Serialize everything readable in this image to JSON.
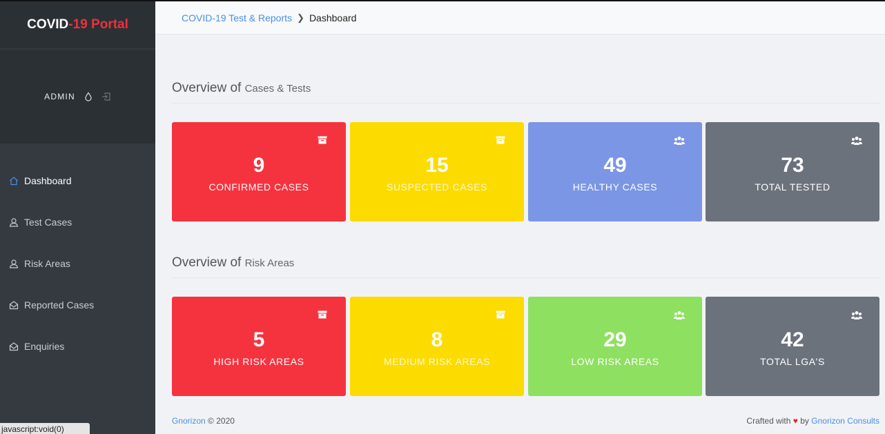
{
  "brand": {
    "part1": "COVID",
    "part2": "-19 Portal"
  },
  "user": {
    "name": "ADMIN"
  },
  "nav": [
    {
      "label": "Dashboard"
    },
    {
      "label": "Test Cases"
    },
    {
      "label": "Risk Areas"
    },
    {
      "label": "Reported Cases"
    },
    {
      "label": "Enquiries"
    }
  ],
  "status_bar": "javascript:void(0)",
  "breadcrumb": {
    "link": "COVID-19 Test & Reports",
    "current": "Dashboard"
  },
  "sections": [
    {
      "title": "Overview of",
      "subtitle": "Cases & Tests",
      "cards": [
        {
          "value": "9",
          "label": "CONFIRMED CASES",
          "color": "#f5333f",
          "icon": "archive-icon"
        },
        {
          "value": "15",
          "label": "SUSPECTED CASES",
          "color": "#fbdb00",
          "icon": "archive-icon"
        },
        {
          "value": "49",
          "label": "HEALTHY CASES",
          "color": "#7b96e4",
          "icon": "users-icon"
        },
        {
          "value": "73",
          "label": "TOTAL TESTED",
          "color": "#6c727c",
          "icon": "users-icon"
        }
      ]
    },
    {
      "title": "Overview of",
      "subtitle": "Risk Areas",
      "cards": [
        {
          "value": "5",
          "label": "HIGH RISK AREAS",
          "color": "#f5333f",
          "icon": "archive-icon"
        },
        {
          "value": "8",
          "label": "MEDIUM RISK AREAS",
          "color": "#fbdb00",
          "icon": "archive-icon"
        },
        {
          "value": "29",
          "label": "LOW RISK AREAS",
          "color": "#8ee060",
          "icon": "users-icon"
        },
        {
          "value": "42",
          "label": "TOTAL LGA'S",
          "color": "#6c727c",
          "icon": "users-icon"
        }
      ]
    }
  ],
  "footer": {
    "company": "Gnorizon",
    "copyright": "© 2020",
    "crafted": "Crafted with",
    "heart": "♥",
    "by": "by",
    "credit": "Gnorizon Consults"
  }
}
